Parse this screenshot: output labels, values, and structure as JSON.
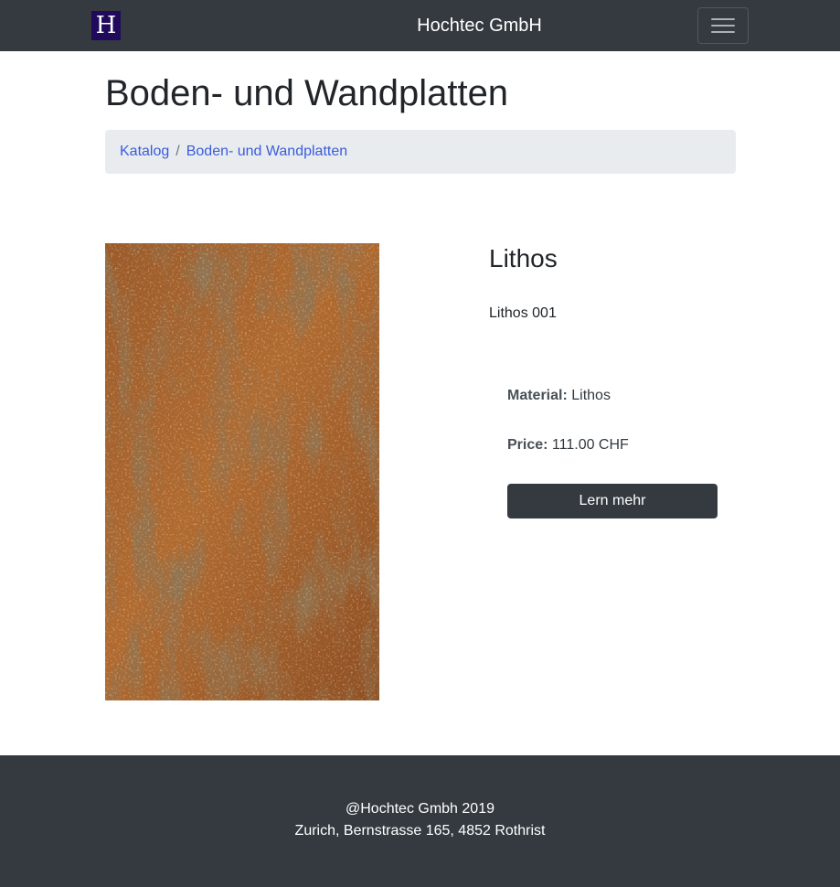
{
  "navbar": {
    "logo_letter": "H",
    "brand": "Hochtec GmbH",
    "toggle_icon": "hamburger-menu-icon"
  },
  "page": {
    "title": "Boden- und Wandplatten"
  },
  "breadcrumb": {
    "items": [
      {
        "label": "Katalog"
      },
      {
        "label": "Boden- und Wandplatten"
      }
    ],
    "separator": "/"
  },
  "product": {
    "image_alt": "Lithos tile texture",
    "name": "Lithos",
    "code": "Lithos 001",
    "material_label": "Material:",
    "material_value": "Lithos",
    "price_label": "Price:",
    "price_value": "111.00 CHF",
    "cta_label": "Lern mehr"
  },
  "footer": {
    "copyright": "@Hochtec Gmbh 2019",
    "address": "Zurich, Bernstrasse 165, 4852 Rothrist"
  },
  "colors": {
    "navbar_bg": "#343a40",
    "logo_bg": "#1f0a5c",
    "breadcrumb_bg": "#e9ecef",
    "link": "#3b5bdb",
    "button_bg": "#343a40",
    "footer_bg": "#343a40"
  }
}
